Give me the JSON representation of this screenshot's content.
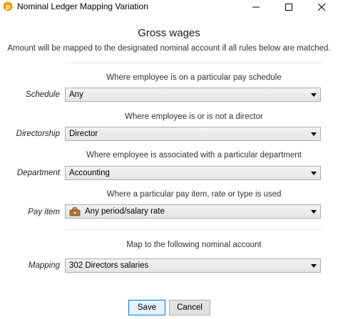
{
  "window": {
    "title": "Nominal Ledger Mapping Variation",
    "icons": {
      "app": "sage-app-icon",
      "minimize": "minimize-icon",
      "maximize": "maximize-icon",
      "close": "close-icon"
    }
  },
  "dialog": {
    "title": "Gross wages",
    "subtitle": "Amount will be mapped to the designated nominal account if all rules below are matched."
  },
  "rules": {
    "schedule": {
      "caption": "Where employee is on a particular pay schedule",
      "label": "Schedule",
      "value": "Any"
    },
    "directorship": {
      "caption": "Where employee is or is not a director",
      "label": "Directorship",
      "value": "Director"
    },
    "department": {
      "caption": "Where employee is associated with a particular department",
      "label": "Department",
      "value": "Accounting"
    },
    "pay_item": {
      "caption": "Where a particular pay item, rate or type is used",
      "label": "Pay item",
      "value": "Any period/salary rate",
      "icon": "money-bag-icon"
    }
  },
  "mapping": {
    "caption": "Map to the following nominal account",
    "label": "Mapping",
    "value": "302 Directors salaries"
  },
  "buttons": {
    "save": "Save",
    "cancel": "Cancel"
  },
  "colors": {
    "accent": "#0078d7",
    "app_icon": "#e8a200"
  }
}
